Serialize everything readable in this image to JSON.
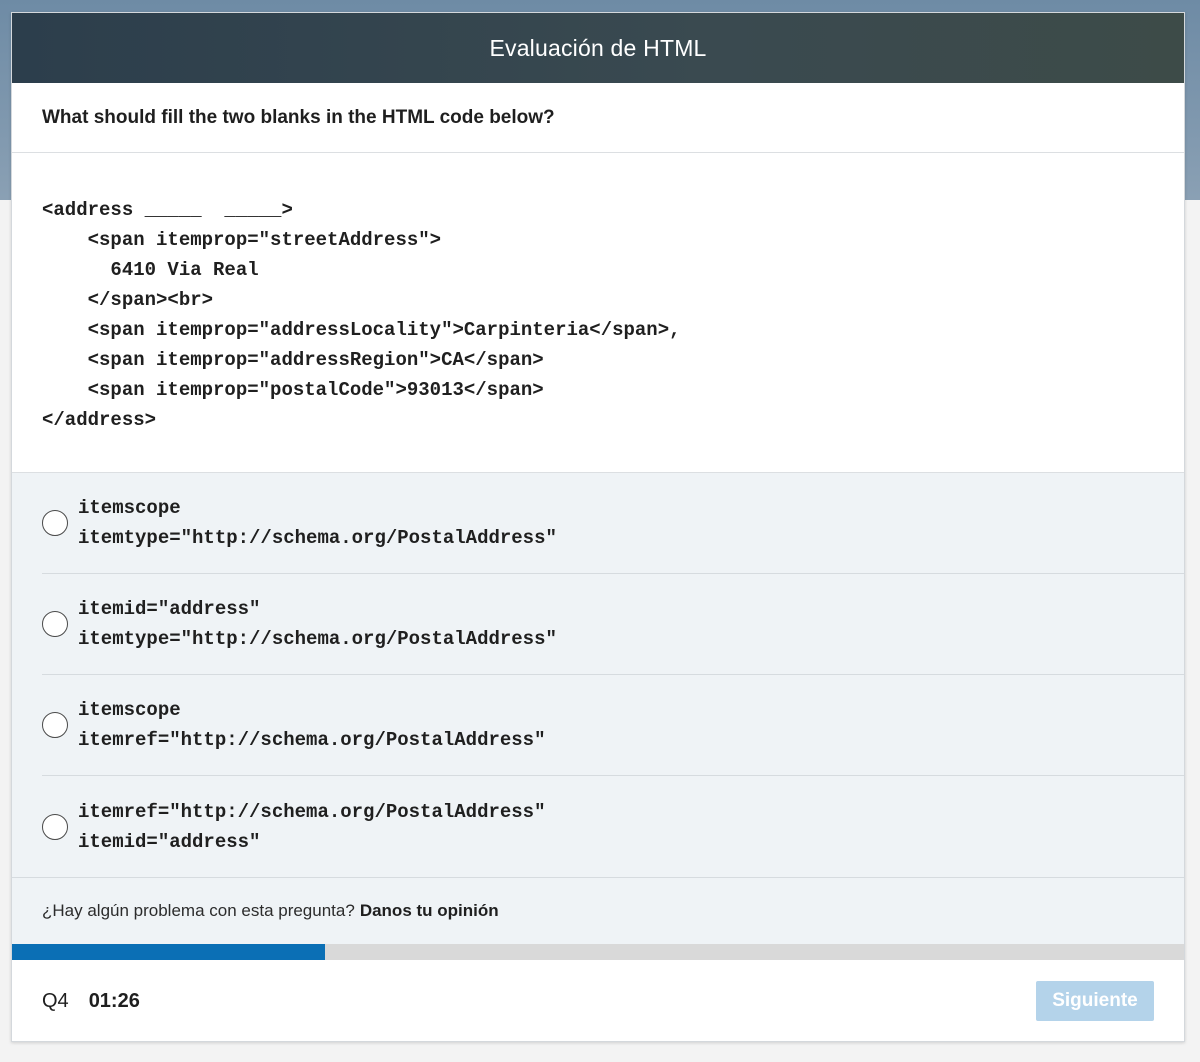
{
  "header": {
    "title": "Evaluación de HTML"
  },
  "question": {
    "text": "What should fill the two blanks in the HTML code below?"
  },
  "code": {
    "lines": [
      "<address _____  _____>",
      "    <span itemprop=\"streetAddress\">",
      "      6410 Via Real",
      "    </span><br>",
      "    <span itemprop=\"addressLocality\">Carpinteria</span>,",
      "    <span itemprop=\"addressRegion\">CA</span>",
      "    <span itemprop=\"postalCode\">93013</span>",
      "</address>"
    ]
  },
  "options": [
    {
      "line1": "itemscope",
      "line2": "itemtype=\"http://schema.org/PostalAddress\"",
      "selected": false
    },
    {
      "line1": "itemid=\"address\"",
      "line2": "itemtype=\"http://schema.org/PostalAddress\"",
      "selected": false
    },
    {
      "line1": "itemscope",
      "line2": "itemref=\"http://schema.org/PostalAddress\"",
      "selected": false
    },
    {
      "line1": "itemref=\"http://schema.org/PostalAddress\"",
      "line2": "itemid=\"address\"",
      "selected": false
    }
  ],
  "feedback": {
    "prompt": "¿Hay algún problema con esta pregunta?",
    "link": "Danos tu opinión"
  },
  "progress": {
    "fraction": 0.267,
    "fill_color": "#0b6fb5"
  },
  "footer": {
    "question_number": "Q4",
    "timer": "01:26",
    "next_label": "Siguiente",
    "next_enabled": false
  }
}
